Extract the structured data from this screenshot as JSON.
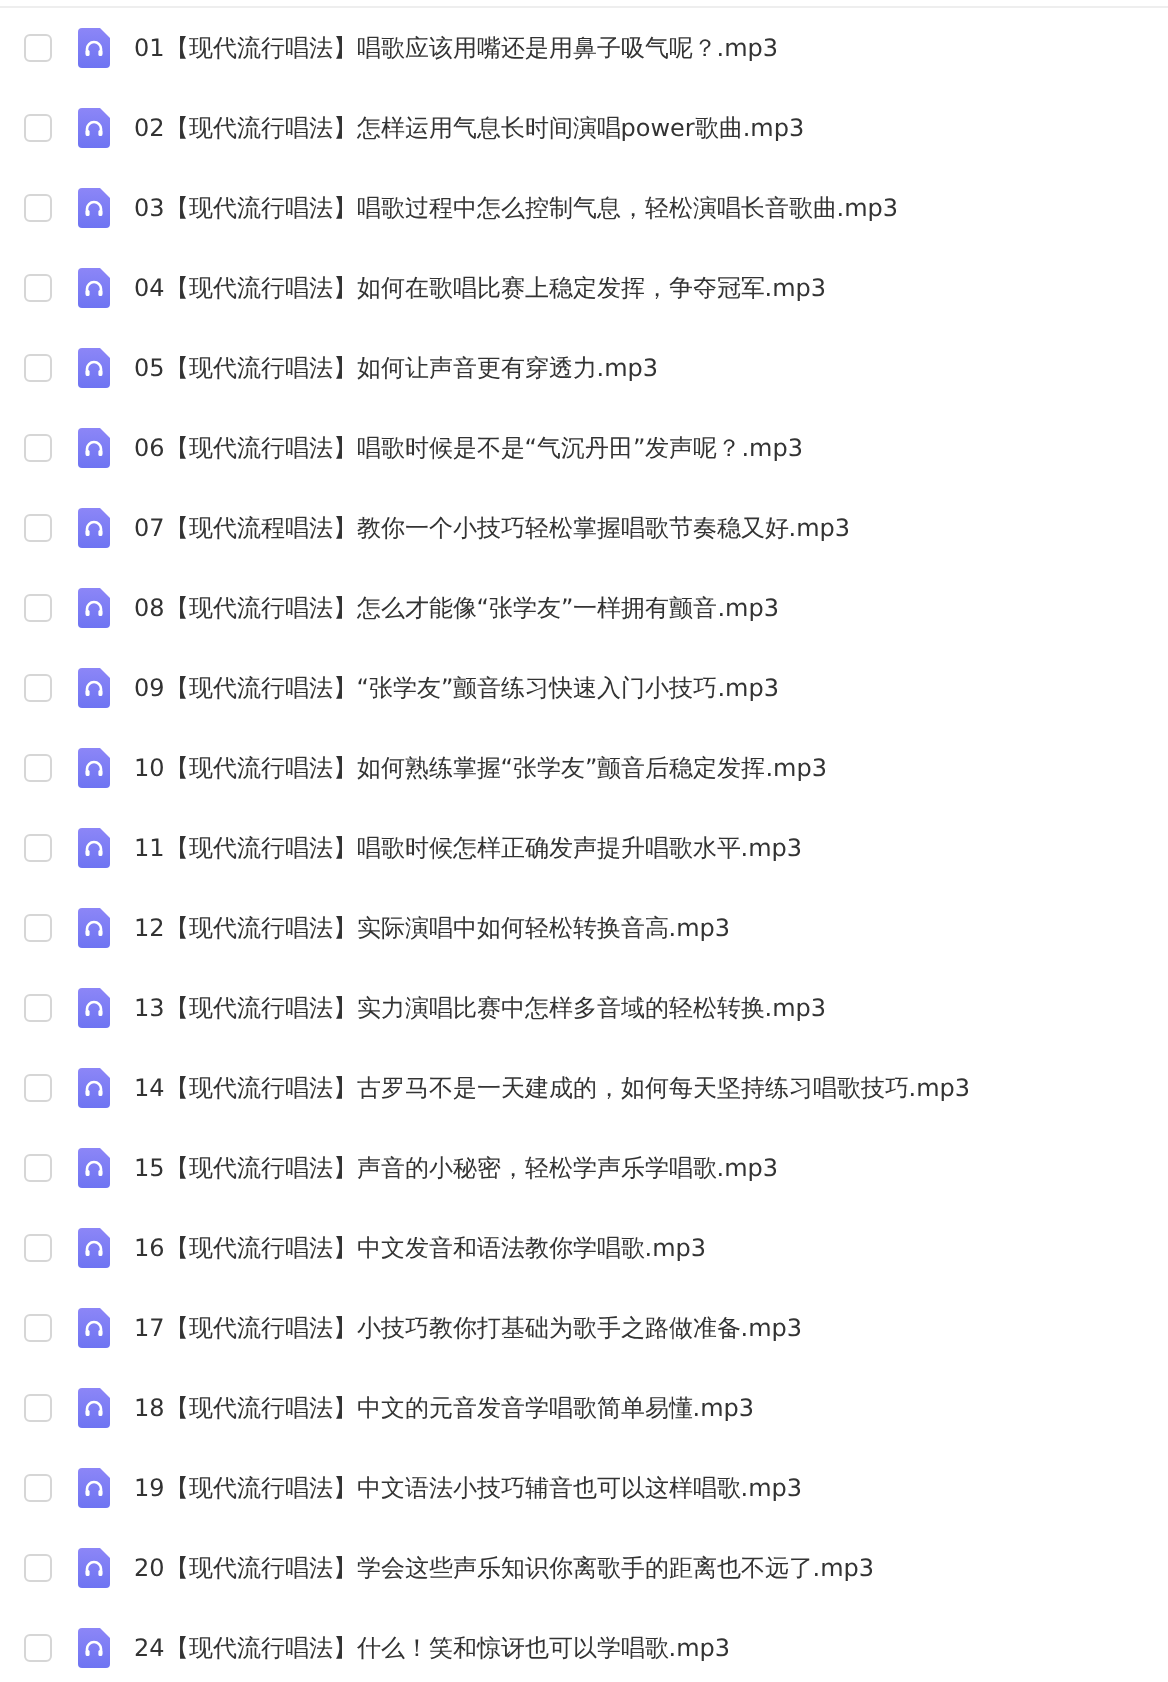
{
  "files": [
    {
      "name": "01【现代流行唱法】唱歌应该用嘴还是用鼻子吸气呢？.mp3",
      "checked": false
    },
    {
      "name": "02【现代流行唱法】怎样运用气息长时间演唱power歌曲.mp3",
      "checked": false
    },
    {
      "name": "03【现代流行唱法】唱歌过程中怎么控制气息，轻松演唱长音歌曲.mp3",
      "checked": false
    },
    {
      "name": "04【现代流行唱法】如何在歌唱比赛上稳定发挥，争夺冠军.mp3",
      "checked": false
    },
    {
      "name": "05【现代流行唱法】如何让声音更有穿透力.mp3",
      "checked": false
    },
    {
      "name": "06【现代流行唱法】唱歌时候是不是“气沉丹田”发声呢？.mp3",
      "checked": false
    },
    {
      "name": "07【现代流程唱法】教你一个小技巧轻松掌握唱歌节奏稳又好.mp3",
      "checked": false
    },
    {
      "name": "08【现代流行唱法】怎么才能像“张学友”一样拥有颤音.mp3",
      "checked": false
    },
    {
      "name": "09【现代流行唱法】“张学友”颤音练习快速入门小技巧.mp3",
      "checked": false
    },
    {
      "name": "10【现代流行唱法】如何熟练掌握“张学友”颤音后稳定发挥.mp3",
      "checked": false
    },
    {
      "name": "11【现代流行唱法】唱歌时候怎样正确发声提升唱歌水平.mp3",
      "checked": false
    },
    {
      "name": "12【现代流行唱法】实际演唱中如何轻松转换音高.mp3",
      "checked": false
    },
    {
      "name": "13【现代流行唱法】实力演唱比赛中怎样多音域的轻松转换.mp3",
      "checked": false
    },
    {
      "name": "14【现代流行唱法】古罗马不是一天建成的，如何每天坚持练习唱歌技巧.mp3",
      "checked": false
    },
    {
      "name": "15【现代流行唱法】声音的小秘密，轻松学声乐学唱歌.mp3",
      "checked": false
    },
    {
      "name": "16【现代流行唱法】中文发音和语法教你学唱歌.mp3",
      "checked": false
    },
    {
      "name": "17【现代流行唱法】小技巧教你打基础为歌手之路做准备.mp3",
      "checked": false
    },
    {
      "name": "18【现代流行唱法】中文的元音发音学唱歌简单易懂.mp3",
      "checked": false
    },
    {
      "name": "19【现代流行唱法】中文语法小技巧辅音也可以这样唱歌.mp3",
      "checked": false
    },
    {
      "name": "20【现代流行唱法】学会这些声乐知识你离歌手的距离也不远了.mp3",
      "checked": false
    },
    {
      "name": "24【现代流行唱法】什么！笑和惊讶也可以学唱歌.mp3",
      "checked": false
    }
  ]
}
